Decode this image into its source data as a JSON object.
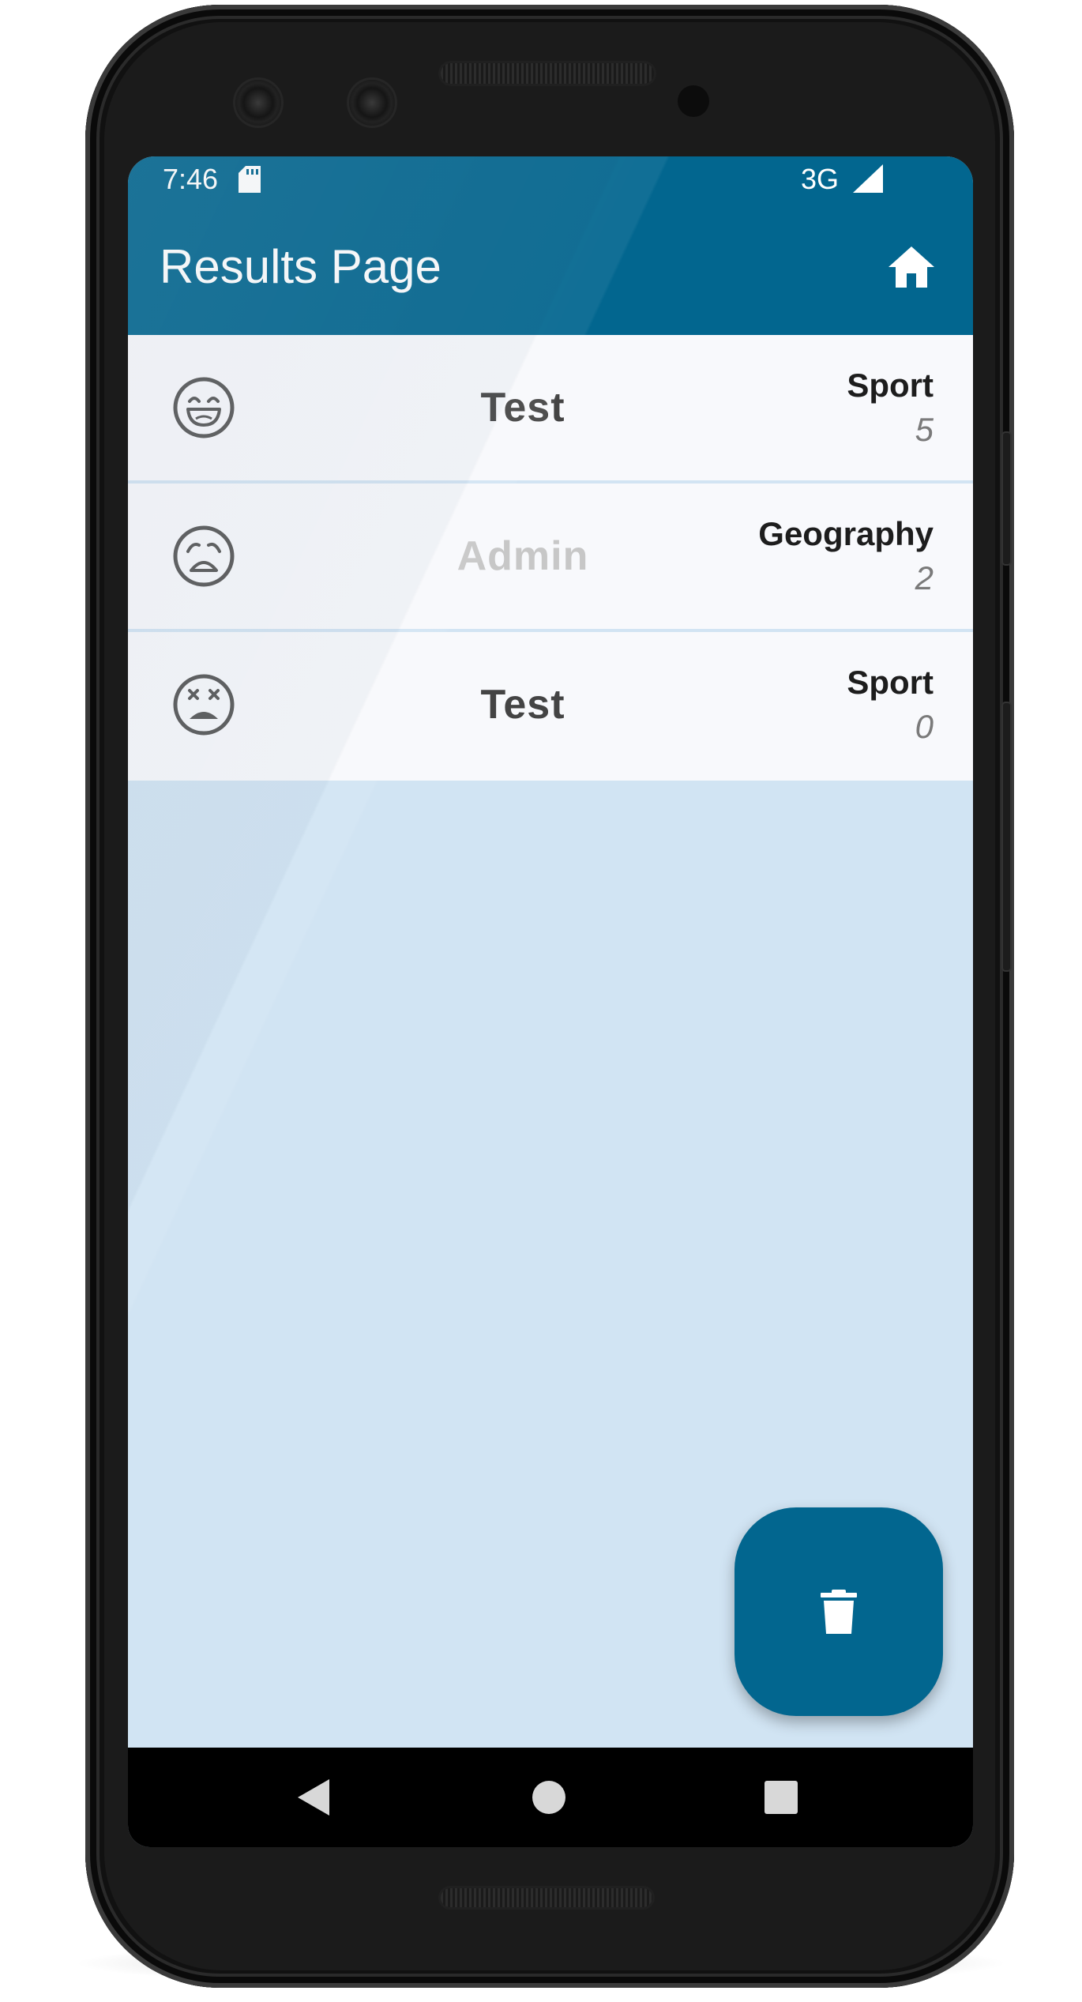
{
  "status_bar": {
    "time": "7:46",
    "network": "3G",
    "icons": [
      "sd-card-icon",
      "signal-icon"
    ]
  },
  "toolbar": {
    "title": "Results Page",
    "home_icon": "home-icon"
  },
  "results": [
    {
      "face": "grinning-face-icon",
      "name": "Test",
      "category": "Sport",
      "score": "5"
    },
    {
      "face": "weary-face-icon",
      "name": "Admin",
      "category": "Geography",
      "score": "2"
    },
    {
      "face": "dizzy-face-icon",
      "name": "Test",
      "category": "Sport",
      "score": "0"
    }
  ],
  "fab": {
    "icon": "trash-icon"
  },
  "nav": {
    "icons": [
      "back-icon",
      "home-circle-icon",
      "recents-icon"
    ]
  },
  "colors": {
    "primary": "#02668f",
    "background": "#d1e4f3",
    "card": "#f8f9fc"
  }
}
